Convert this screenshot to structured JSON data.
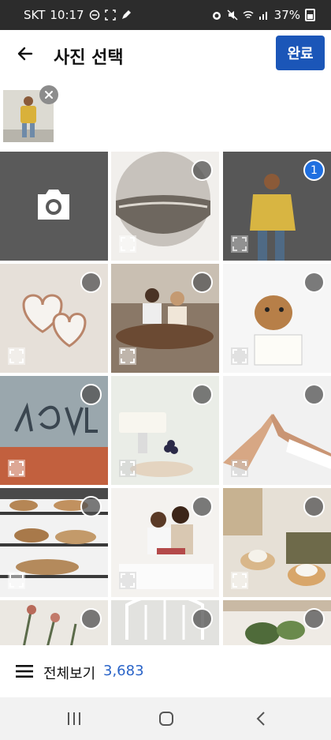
{
  "status_bar": {
    "carrier": "SKT",
    "time": "10:17",
    "battery": "37%"
  },
  "app_bar": {
    "title": "사진 선택",
    "done_label": "완료"
  },
  "selected_strip": {
    "count": 1
  },
  "grid": {
    "cells": [
      {
        "type": "camera",
        "icon": "camera-icon"
      },
      {
        "type": "photo",
        "subject": "circle-beach",
        "selected": false
      },
      {
        "type": "photo",
        "subject": "man-yellow-jacket",
        "selected": true,
        "order": "1"
      },
      {
        "type": "photo",
        "subject": "paper-hearts",
        "selected": false
      },
      {
        "type": "photo",
        "subject": "couple-dining",
        "selected": false
      },
      {
        "type": "photo",
        "subject": "dog-sign",
        "selected": false
      },
      {
        "type": "photo",
        "subject": "love-window",
        "selected": false
      },
      {
        "type": "photo",
        "subject": "cake-grapes",
        "selected": false
      },
      {
        "type": "photo",
        "subject": "high-five",
        "selected": false
      },
      {
        "type": "photo",
        "subject": "bakery-shelves",
        "selected": false
      },
      {
        "type": "photo",
        "subject": "mother-child-reading",
        "selected": false
      },
      {
        "type": "photo",
        "subject": "cafe-table",
        "selected": false
      },
      {
        "type": "photo",
        "subject": "flowers",
        "selected": false
      },
      {
        "type": "photo",
        "subject": "window-room",
        "selected": false
      },
      {
        "type": "photo",
        "subject": "plants",
        "selected": false
      }
    ]
  },
  "bottom_bar": {
    "all_label": "전체보기",
    "count": "3,683"
  },
  "colors": {
    "accent": "#1b56b8",
    "count_blue": "#2a64c8",
    "selected_badge": "#1f6fe0",
    "status_bar": "#2c2c2c"
  }
}
